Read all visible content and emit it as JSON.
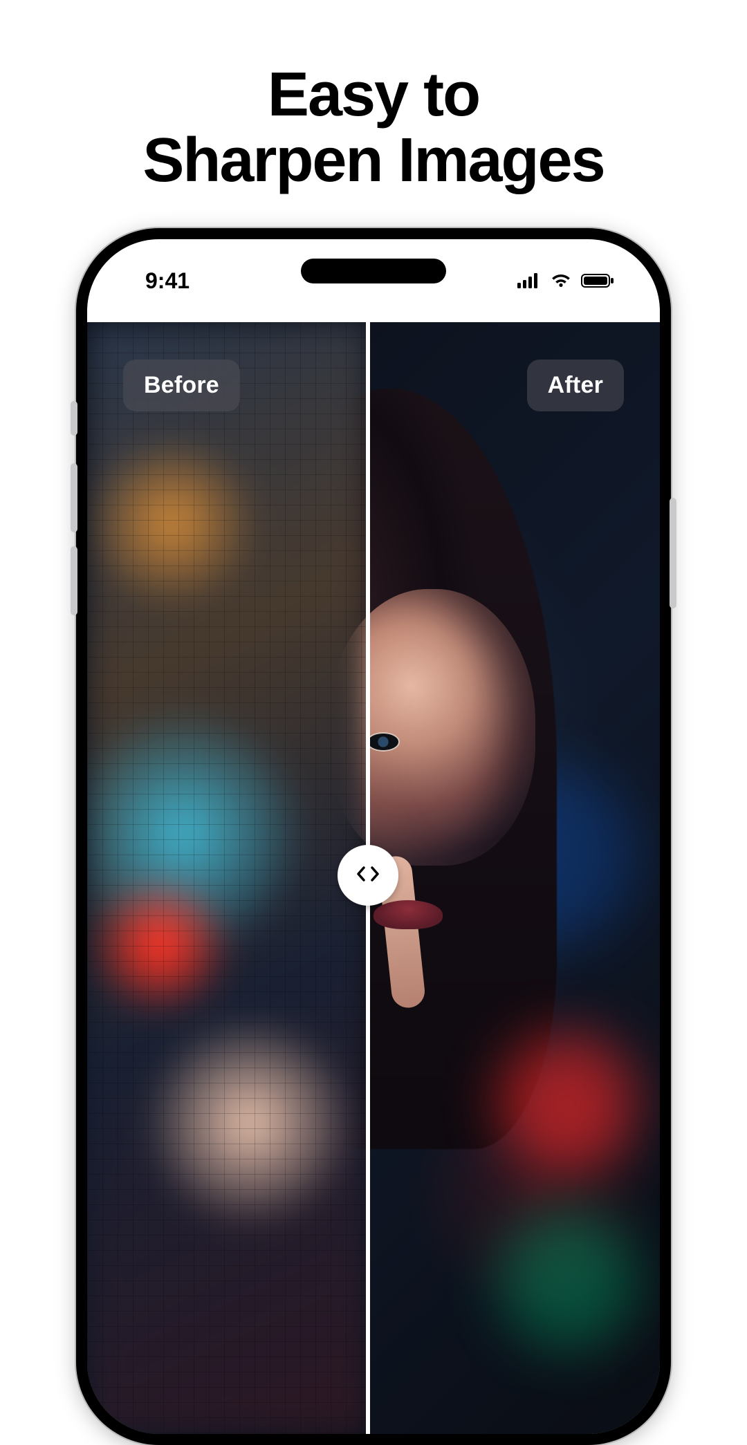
{
  "headline": {
    "line1": "Easy to",
    "line2": "Sharpen Images"
  },
  "statusbar": {
    "time": "9:41"
  },
  "comparison": {
    "before_label": "Before",
    "after_label": "After",
    "slider_position_percent": 49
  },
  "icons": {
    "signal": "signal-icon",
    "wifi": "wifi-icon",
    "battery": "battery-icon",
    "slider_handle": "compare-arrows-icon"
  },
  "colors": {
    "text": "#000000",
    "pill_bg": "rgba(80,80,88,.55)",
    "pill_text": "#FFFFFF",
    "divider": "#FFFFFF"
  }
}
